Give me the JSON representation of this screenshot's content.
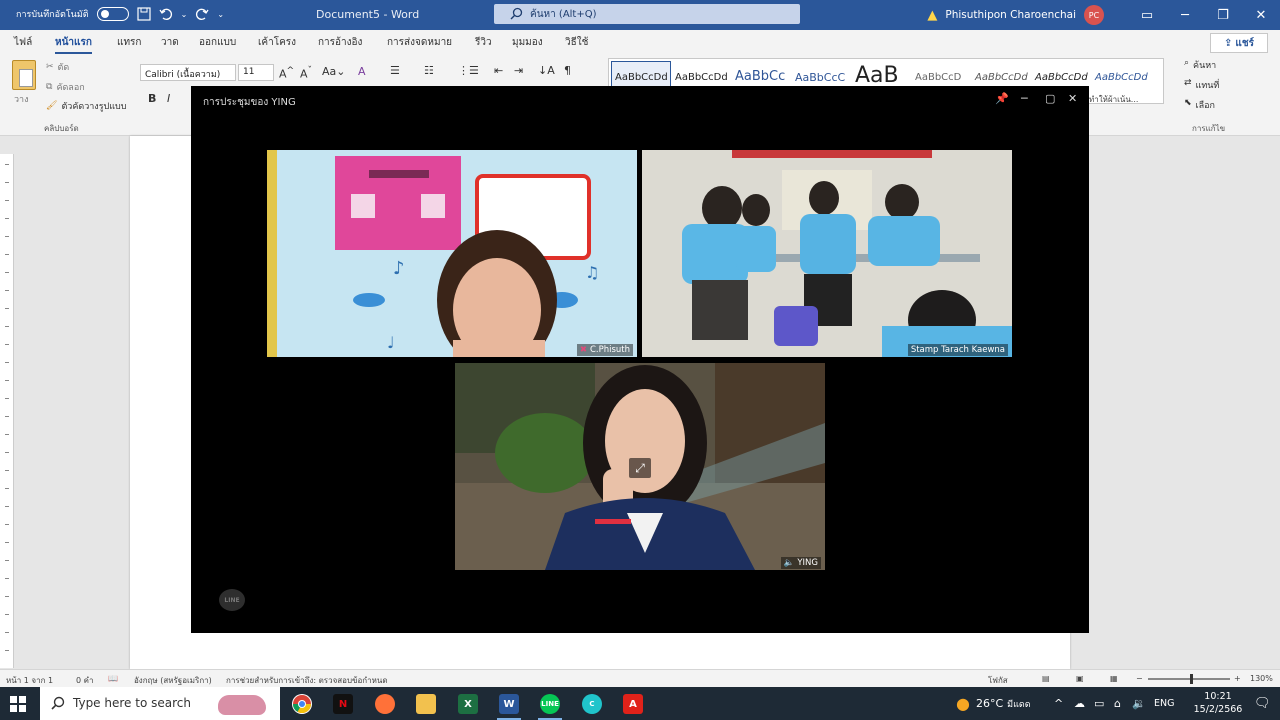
{
  "word": {
    "autosave_label": "การบันทึกอัตโนมัติ",
    "doc_title": "Document5 - Word",
    "search_placeholder": "ค้นหา (Alt+Q)",
    "user_name": "Phisuthipon Charoenchai",
    "user_initials": "PC",
    "tabs": [
      "ไฟล์",
      "หน้าแรก",
      "แทรก",
      "วาด",
      "ออกแบบ",
      "เค้าโครง",
      "การอ้างอิง",
      "การส่งจดหมาย",
      "รีวิว",
      "มุมมอง",
      "วิธีใช้"
    ],
    "share_label": "แชร์",
    "ribbon": {
      "paste_label": "วาง",
      "cut_label": "ตัด",
      "copy_label": "คัดลอก",
      "format_painter_label": "ตัวคัดวางรูปแบบ",
      "clipboard_group": "คลิปบอร์ด",
      "font_name": "Calibri (เนื้อความ)",
      "font_size": "11",
      "styles": [
        "AaBbCcDd",
        "AaBbCcDd",
        "AaBbCc",
        "AaBbCcC",
        "AaB",
        "AaBbCcD",
        "AaBbCcDd",
        "AaBbCcDd",
        "AaBbCcDd"
      ],
      "styles_more_label": "ทำให้ผ้าเน้น...",
      "find_label": "ค้นหา",
      "replace_label": "แทนที่",
      "select_label": "เลือก",
      "editing_group": "การแก้ไข"
    },
    "status": {
      "page": "หน้า 1 จาก 1",
      "words": "0 คำ",
      "language": "อังกฤษ (สหรัฐอเมริกา)",
      "accessibility": "การช่วยสำหรับการเข้าถึง: ตรวจสอบข้อกำหนด",
      "focus": "โฟกัส",
      "zoom": "130%"
    }
  },
  "meeting": {
    "title": "การประชุมของ YING",
    "participants": [
      {
        "name": "C.Phisuth"
      },
      {
        "name": "Stamp Tarach Kaewna"
      },
      {
        "name": "YING"
      }
    ],
    "app_badge": "LINE"
  },
  "taskbar": {
    "search_placeholder": "Type here to search",
    "weather": "26°C",
    "weather_desc": "มีแดด",
    "language": "ENG",
    "time": "10:21",
    "date": "15/2/2566"
  }
}
